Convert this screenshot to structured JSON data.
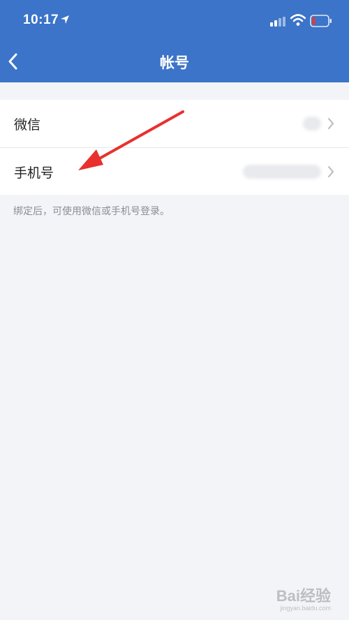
{
  "status_bar": {
    "time": "10:17",
    "icons": [
      "location-arrow-icon",
      "cellular-signal-icon",
      "wifi-icon",
      "battery-low-icon"
    ]
  },
  "nav": {
    "title": "帐号",
    "back_icon": "chevron-left-icon"
  },
  "rows": [
    {
      "label": "微信",
      "value": "",
      "chevron": "chevron-right-icon"
    },
    {
      "label": "手机号",
      "value": "",
      "chevron": "chevron-right-icon"
    }
  ],
  "footnote": "绑定后，可使用微信或手机号登录。",
  "annotation": {
    "color": "#e8312e",
    "points_to": "手机号"
  },
  "watermark": {
    "text": "Bai经验",
    "sub": "jingyan.baidu.com"
  },
  "colors": {
    "accent": "#3b74c8",
    "background": "#f3f4f8",
    "battery_low": "#e53935"
  }
}
